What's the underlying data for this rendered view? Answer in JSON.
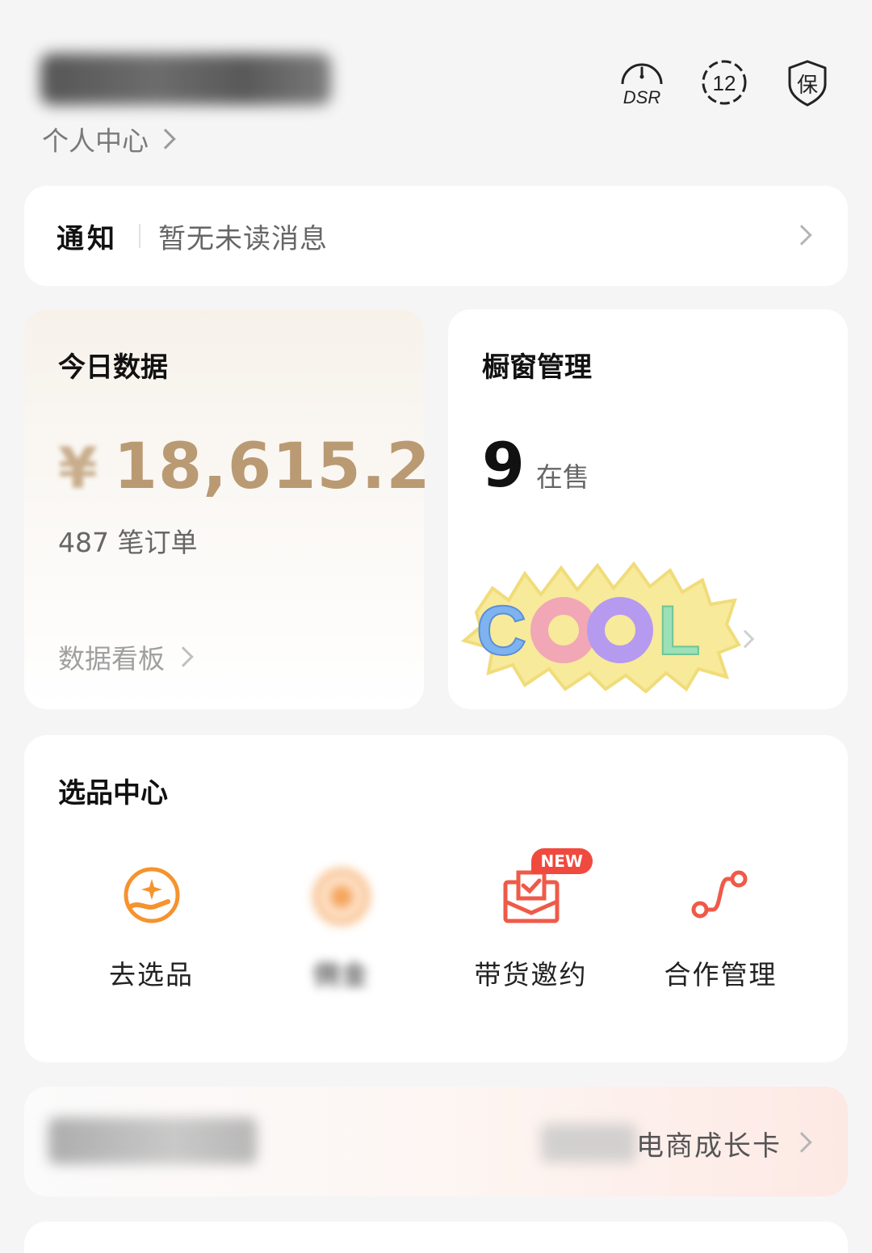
{
  "header": {
    "profile_link": "个人中心",
    "icons": [
      {
        "name": "dsr-icon",
        "label": "DSR"
      },
      {
        "name": "clock-12-icon",
        "label": "12"
      },
      {
        "name": "guarantee-shield-icon",
        "label": "保"
      }
    ]
  },
  "notice": {
    "title": "通知",
    "text": "暂无未读消息"
  },
  "today": {
    "title": "今日数据",
    "currency": "¥",
    "amount": "18,615.2",
    "orders": "487 笔订单",
    "board_link": "数据看板"
  },
  "window": {
    "title": "橱窗管理",
    "count": "9",
    "count_label": "在售",
    "sticker_text": "COOL"
  },
  "select": {
    "title": "选品中心",
    "tools": [
      {
        "label": "去选品",
        "icon": "select-product-icon"
      },
      {
        "label": "佣金",
        "icon": "commission-icon"
      },
      {
        "label": "带货邀约",
        "icon": "invite-mail-icon",
        "badge": "NEW"
      },
      {
        "label": "合作管理",
        "icon": "cooperation-icon"
      }
    ]
  },
  "growth": {
    "label": "电商成长卡"
  },
  "colors": {
    "accent_orange": "#f5932e",
    "accent_red": "#ef5a48",
    "amount_gold": "#b99a73"
  }
}
